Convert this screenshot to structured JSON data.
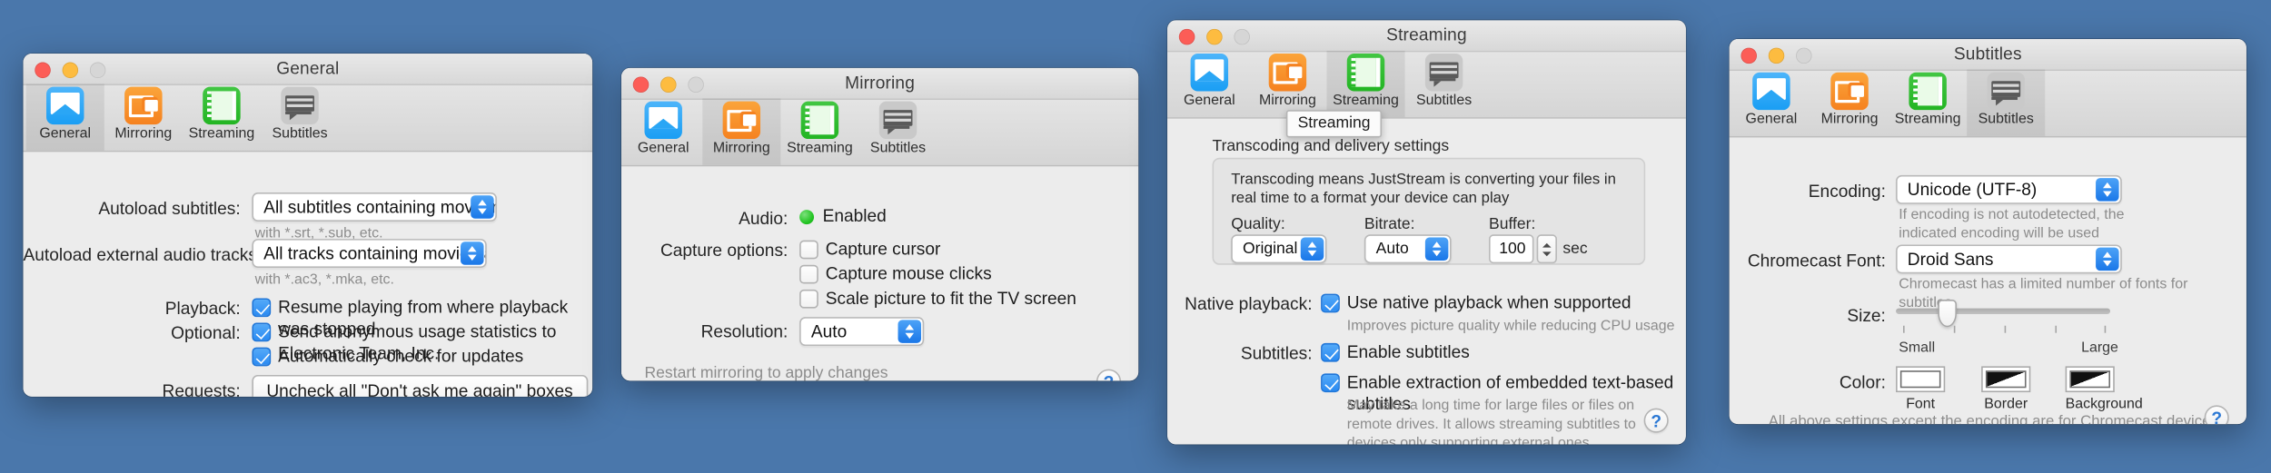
{
  "desktop": {
    "background_color": "#4a77ab"
  },
  "tabs": [
    {
      "id": "general",
      "label": "General",
      "icon": "airplay-display-icon"
    },
    {
      "id": "mirroring",
      "label": "Mirroring",
      "icon": "screen-mirroring-icon"
    },
    {
      "id": "streaming",
      "label": "Streaming",
      "icon": "film-strip-icon"
    },
    {
      "id": "subtitles",
      "label": "Subtitles",
      "icon": "subtitle-caption-icon"
    }
  ],
  "windows": {
    "general": {
      "title": "General",
      "selected_tab": "General",
      "rows": {
        "autoload_subtitles_label": "Autoload subtitles:",
        "autoload_subtitles_value": "All subtitles containing movie name",
        "autoload_subtitles_hint": "with *.srt, *.sub, etc.",
        "autoload_audio_label": "Autoload external audio tracks:",
        "autoload_audio_value": "All tracks containing movie name",
        "autoload_audio_hint": "with *.ac3, *.mka, etc.",
        "playback_label": "Playback:",
        "playback_checkbox": "Resume playing from where playback was stopped",
        "playback_checked": true,
        "optional_label": "Optional:",
        "optional_checkbox_1": "Send anonymous usage statistics to Electronic Team, Inc.",
        "optional_checkbox_1_checked": true,
        "optional_checkbox_2": "Automatically check for updates",
        "optional_checkbox_2_checked": true,
        "requests_label": "Requests:",
        "requests_button": "Uncheck all \"Don't ask me again\" boxes"
      },
      "help_label": "?"
    },
    "mirroring": {
      "title": "Mirroring",
      "selected_tab": "Mirroring",
      "rows": {
        "audio_label": "Audio:",
        "audio_status": "Enabled",
        "audio_status_color": "#23c423",
        "capture_label": "Capture options:",
        "capture_1": "Capture cursor",
        "capture_1_checked": false,
        "capture_2": "Capture mouse clicks",
        "capture_2_checked": false,
        "capture_3": "Scale picture to fit the TV screen",
        "capture_3_checked": false,
        "resolution_label": "Resolution:",
        "resolution_value": "Auto"
      },
      "footnote": "Restart mirroring to apply changes",
      "help_label": "?"
    },
    "streaming": {
      "title": "Streaming",
      "selected_tab": "Streaming",
      "tooltip": "Streaming",
      "group_title": "Transcoding and delivery settings",
      "group_description": "Transcoding means JustStream is converting your files in real time to a format your device can play",
      "quality_label": "Quality:",
      "quality_value": "Original",
      "bitrate_label": "Bitrate:",
      "bitrate_value": "Auto",
      "buffer_label": "Buffer:",
      "buffer_value": "100",
      "buffer_unit": "sec",
      "native_label": "Native playback:",
      "native_checkbox": "Use native playback when supported",
      "native_checked": true,
      "native_hint": "Improves picture quality while reducing CPU usage",
      "subtitles_label": "Subtitles:",
      "subtitles_checkbox_1": "Enable subtitles",
      "subtitles_checkbox_1_checked": true,
      "subtitles_checkbox_2": "Enable extraction of embedded text-based subtitles",
      "subtitles_checkbox_2_checked": true,
      "subtitles_hint": "May take a long time for large files or files on remote drives. It allows streaming subtitles to devices only supporting external ones.",
      "help_label": "?"
    },
    "subtitles": {
      "title": "Subtitles",
      "selected_tab": "Subtitles",
      "encoding_label": "Encoding:",
      "encoding_value": "Unicode (UTF-8)",
      "encoding_hint": "If encoding is not autodetected, the indicated encoding will be used",
      "font_label": "Chromecast Font:",
      "font_value": "Droid Sans",
      "font_hint": "Chromecast has a limited number of fonts for subtitles",
      "size_label": "Size:",
      "size_min_label": "Small",
      "size_max_label": "Large",
      "size_value_percent": 22,
      "color_label": "Color:",
      "swatches": [
        {
          "caption": "Font",
          "style": "white"
        },
        {
          "caption": "Border",
          "style": "diag"
        },
        {
          "caption": "Background",
          "style": "diag"
        }
      ],
      "footnote": "All above settings except the encoding are for Chromecast devices only",
      "help_label": "?"
    }
  }
}
